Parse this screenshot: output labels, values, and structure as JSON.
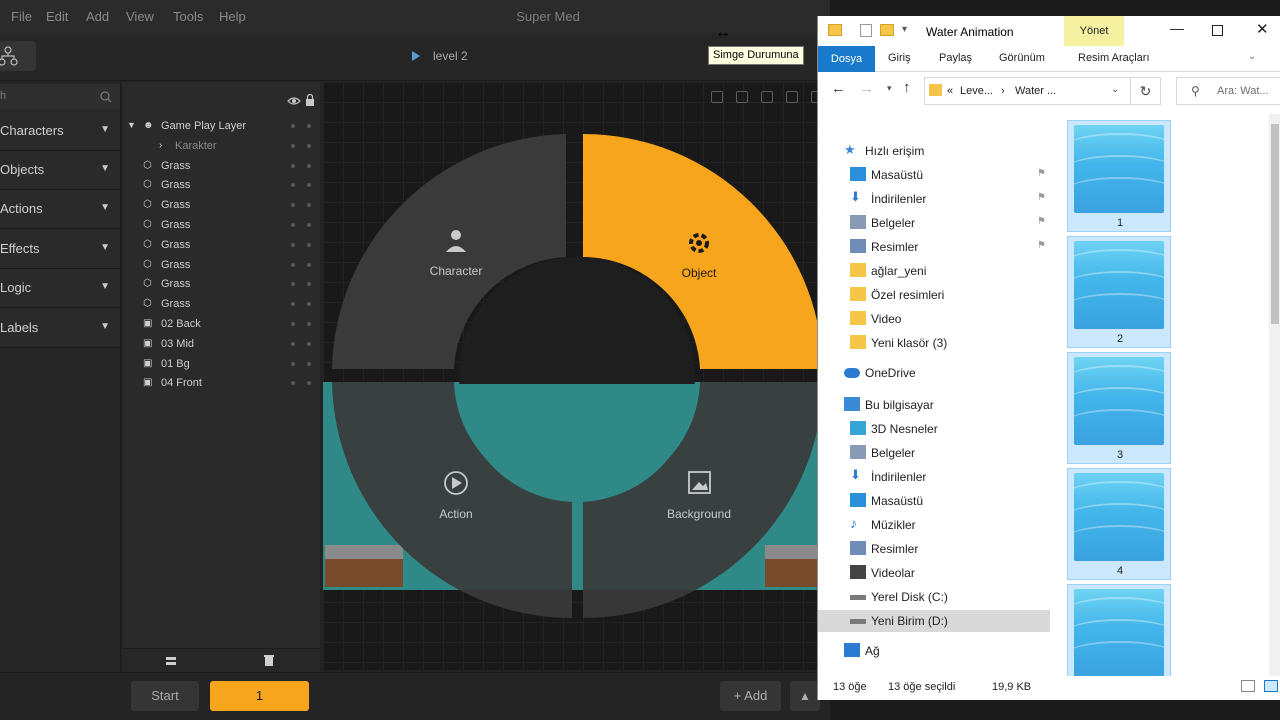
{
  "editor": {
    "menu": [
      "File",
      "Edit",
      "Add",
      "View",
      "Tools",
      "Help"
    ],
    "app_title": "Super Med",
    "level_label": "level 2",
    "search_partial": "h",
    "categories": [
      "Characters",
      "Objects",
      "Actions",
      "Effects",
      "Logic",
      "Labels"
    ],
    "layers": [
      {
        "name": "Game Play Layer",
        "kind": "group"
      },
      {
        "name": "Karakter",
        "kind": "child"
      },
      {
        "name": "Grass",
        "kind": "object"
      },
      {
        "name": "Grass",
        "kind": "object"
      },
      {
        "name": "Grass",
        "kind": "object"
      },
      {
        "name": "Grass",
        "kind": "object"
      },
      {
        "name": "Grass",
        "kind": "object"
      },
      {
        "name": "Grass",
        "kind": "object"
      },
      {
        "name": "Grass",
        "kind": "object"
      },
      {
        "name": "Grass",
        "kind": "object"
      },
      {
        "name": "02 Back",
        "kind": "image"
      },
      {
        "name": "03 Mid",
        "kind": "image"
      },
      {
        "name": "01 Bg",
        "kind": "image"
      },
      {
        "name": "04 Front",
        "kind": "image"
      }
    ],
    "radial_menu": {
      "character": "Character",
      "object": "Object",
      "action": "Action",
      "background": "Background"
    },
    "bottom": {
      "start": "Start",
      "frame": "1",
      "add": "+ Add"
    },
    "tooltip": "Simge Durumuna",
    "accent": "#f7a51c"
  },
  "explorer": {
    "title": "Water Animation",
    "manage_tab": "Yönet",
    "ribbon_tabs": [
      "Dosya",
      "Giriş",
      "Paylaş",
      "Görünüm",
      "Resim Araçları"
    ],
    "address": [
      "«",
      "Leve...",
      "›",
      "Water ..."
    ],
    "search_placeholder": "Ara: Wat...",
    "nav": [
      {
        "label": "Hızlı erişim",
        "icon": "star-icon",
        "pinned": false,
        "indent": 0
      },
      {
        "label": "Masaüstü",
        "icon": "desktop-icon",
        "pinned": true,
        "indent": 1
      },
      {
        "label": "İndirilenler",
        "icon": "download-icon",
        "pinned": true,
        "indent": 1
      },
      {
        "label": "Belgeler",
        "icon": "documents-icon",
        "pinned": true,
        "indent": 1
      },
      {
        "label": "Resimler",
        "icon": "pictures-icon",
        "pinned": true,
        "indent": 1
      },
      {
        "label": "ağlar_yeni",
        "icon": "folder-icon",
        "pinned": false,
        "indent": 1
      },
      {
        "label": "Özel resimleri",
        "icon": "folder-icon",
        "pinned": false,
        "indent": 1
      },
      {
        "label": "Video",
        "icon": "folder-icon",
        "pinned": false,
        "indent": 1
      },
      {
        "label": "Yeni klasör (3)",
        "icon": "folder-icon",
        "pinned": false,
        "indent": 1
      },
      {
        "label": "OneDrive",
        "icon": "cloud-icon",
        "pinned": false,
        "indent": 0
      },
      {
        "label": "Bu bilgisayar",
        "icon": "computer-icon",
        "pinned": false,
        "indent": 0
      },
      {
        "label": "3D Nesneler",
        "icon": "cube-icon",
        "pinned": false,
        "indent": 1
      },
      {
        "label": "Belgeler",
        "icon": "documents-icon",
        "pinned": false,
        "indent": 1
      },
      {
        "label": "İndirilenler",
        "icon": "download-icon",
        "pinned": false,
        "indent": 1
      },
      {
        "label": "Masaüstü",
        "icon": "desktop-icon",
        "pinned": false,
        "indent": 1
      },
      {
        "label": "Müzikler",
        "icon": "music-icon",
        "pinned": false,
        "indent": 1
      },
      {
        "label": "Resimler",
        "icon": "pictures-icon",
        "pinned": false,
        "indent": 1
      },
      {
        "label": "Videolar",
        "icon": "video-icon",
        "pinned": false,
        "indent": 1
      },
      {
        "label": "Yerel Disk (C:)",
        "icon": "drive-icon",
        "pinned": false,
        "indent": 1
      },
      {
        "label": "Yeni Birim (D:)",
        "icon": "drive-icon",
        "pinned": false,
        "indent": 1
      },
      {
        "label": "Ağ",
        "icon": "network-icon",
        "pinned": false,
        "indent": 0
      }
    ],
    "files": [
      "1",
      "2",
      "3",
      "4",
      ""
    ],
    "status": {
      "count": "13 öğe",
      "selected": "13 öğe seçildi",
      "size": "19,9 KB"
    },
    "accent": "#1979ca"
  }
}
